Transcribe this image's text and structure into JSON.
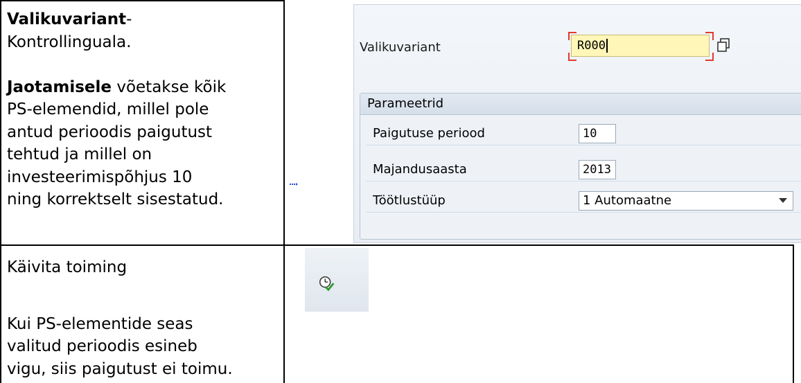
{
  "left_column": {
    "row1": {
      "line1_bold": "Valikuvariant",
      "line1_rest": "-",
      "line2": "Kontrollinguala.",
      "para_bold": "Jaotamisele",
      "para_lines": [
        "võetakse kõik",
        "PS-elemendid, millel pole",
        "antud perioodis paigutust",
        "tehtud ja millel on",
        "investeerimispõhjus 10",
        "ning korrektselt sisestatud."
      ]
    },
    "row2": {
      "line1": "Käivita toiming",
      "para_lines": [
        "Kui PS-elementide seas",
        "valitud perioodis esineb",
        "vigu, siis paigutust ei toimu."
      ]
    }
  },
  "sap_selection": {
    "variant_label": "Valikuvariant",
    "variant_value": "R000",
    "group_title": "Parameetrid",
    "params": [
      {
        "label": "Paigutuse periood",
        "value": "10"
      },
      {
        "label": "Majandusaasta",
        "value": "2013"
      },
      {
        "label": "Töötlustüüp",
        "value": "1 Automaatne"
      }
    ],
    "required_marker_color": "#e03a2e",
    "field_highlight_color": "#fff6b8"
  },
  "sap_toolbar": {
    "execute_icon": "execute-clock-check-icon"
  }
}
